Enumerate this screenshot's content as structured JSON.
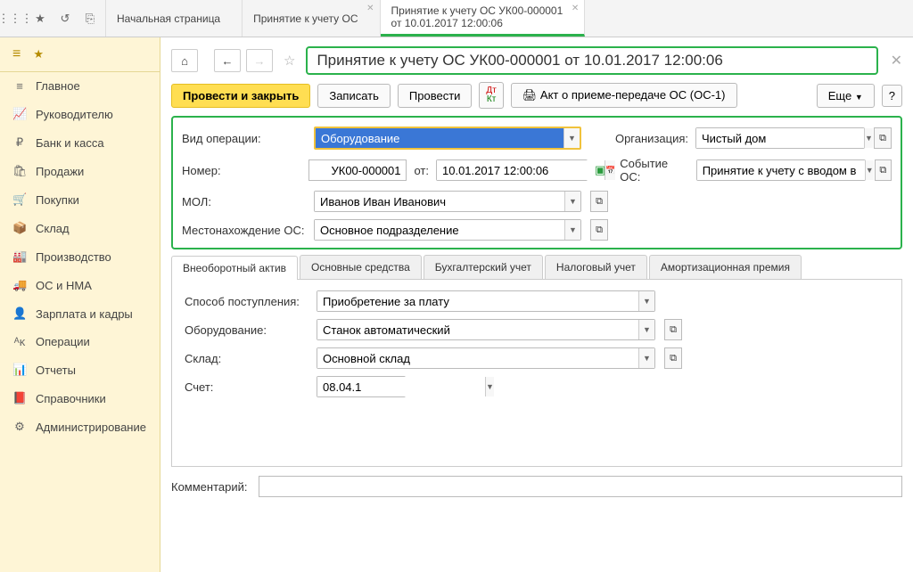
{
  "topTabs": [
    {
      "l1": "Начальная страница",
      "l2": ""
    },
    {
      "l1": "Принятие к учету ОС",
      "l2": ""
    },
    {
      "l1": "Принятие к учету ОС УК00-000001",
      "l2": "от 10.01.2017 12:00:06"
    }
  ],
  "sidebar": [
    {
      "icon": "≡",
      "label": "Главное"
    },
    {
      "icon": "📈",
      "label": "Руководителю"
    },
    {
      "icon": "₽",
      "label": "Банк и касса"
    },
    {
      "icon": "🛍",
      "label": "Продажи"
    },
    {
      "icon": "🛒",
      "label": "Покупки"
    },
    {
      "icon": "📦",
      "label": "Склад"
    },
    {
      "icon": "🏭",
      "label": "Производство"
    },
    {
      "icon": "🚚",
      "label": "ОС и НМА"
    },
    {
      "icon": "👤",
      "label": "Зарплата и кадры"
    },
    {
      "icon": "ᴬᴋ",
      "label": "Операции"
    },
    {
      "icon": "📊",
      "label": "Отчеты"
    },
    {
      "icon": "📕",
      "label": "Справочники"
    },
    {
      "icon": "⚙",
      "label": "Администрирование"
    }
  ],
  "title": "Принятие к учету ОС УК00-000001 от 10.01.2017 12:00:06",
  "toolbar": {
    "main": "Провести и закрыть",
    "save": "Записать",
    "post": "Провести",
    "act": "Акт о приеме-передаче ОС (ОС-1)",
    "more": "Еще"
  },
  "form": {
    "opTypeLabel": "Вид операции:",
    "opType": "Оборудование",
    "orgLabel": "Организация:",
    "org": "Чистый дом",
    "numLabel": "Номер:",
    "num": "УК00-000001",
    "dateLabel": "от:",
    "date": "10.01.2017 12:00:06",
    "eventLabel": "Событие ОС:",
    "event": "Принятие к учету с вводом в :",
    "molLabel": "МОЛ:",
    "mol": "Иванов Иван Иванович",
    "locLabel": "Местонахождение ОС:",
    "loc": "Основное подразделение"
  },
  "detailTabs": [
    "Внеоборотный актив",
    "Основные средства",
    "Бухгалтерский учет",
    "Налоговый учет",
    "Амортизационная премия"
  ],
  "detail": {
    "methodLabel": "Способ поступления:",
    "method": "Приобретение за плату",
    "equipLabel": "Оборудование:",
    "equip": "Станок автоматический",
    "storeLabel": "Склад:",
    "store": "Основной склад",
    "accLabel": "Счет:",
    "acc": "08.04.1"
  },
  "commentLabel": "Комментарий:",
  "comment": ""
}
